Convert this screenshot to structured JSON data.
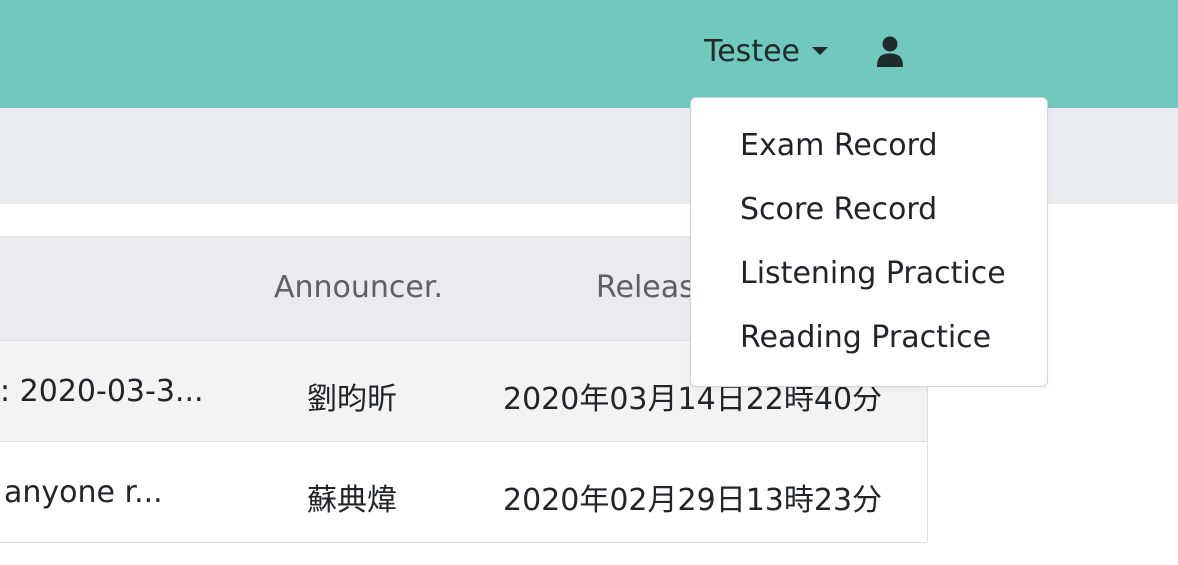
{
  "navbar": {
    "user_name": "Testee",
    "user_icon": "user-icon",
    "accent": "#71c8bd"
  },
  "table": {
    "headers": {
      "announcer": "Announcer.",
      "release": "Releas"
    },
    "rows": [
      {
        "title": ": 2020-03-3...",
        "announcer": "劉昀昕",
        "date": "2020年03月14日22時40分"
      },
      {
        "title": "anyone r...",
        "announcer": "蘇典煒",
        "date": "2020年02月29日13時23分"
      }
    ]
  },
  "dropdown": {
    "items": [
      "Exam Record",
      "Score Record",
      "Listening Practice",
      "Reading Practice"
    ]
  }
}
